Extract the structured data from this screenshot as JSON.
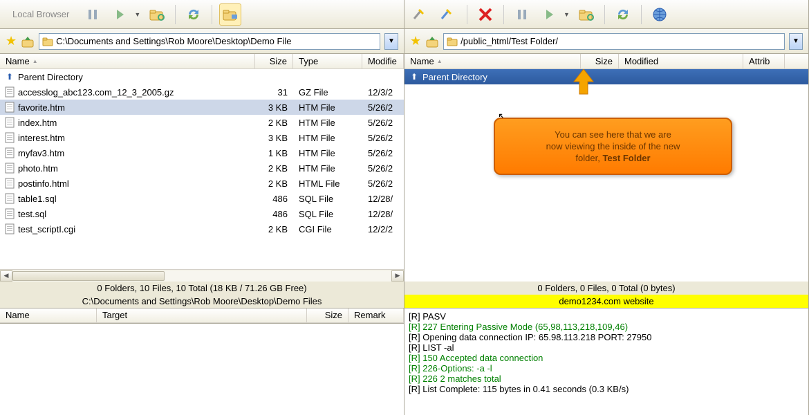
{
  "left": {
    "toolbar_label": "Local Browser",
    "address": "C:\\Documents and Settings\\Rob Moore\\Desktop\\Demo File",
    "columns": {
      "name": "Name",
      "size": "Size",
      "type": "Type",
      "modified": "Modifie"
    },
    "parent_dir": "Parent Directory",
    "files": [
      {
        "name": "accesslog_abc123.com_12_3_2005.gz",
        "size": "31",
        "type": "GZ File",
        "mod": "12/3/2"
      },
      {
        "name": "favorite.htm",
        "size": "3 KB",
        "type": "HTM File",
        "mod": "5/26/2",
        "selected": true
      },
      {
        "name": "index.htm",
        "size": "2 KB",
        "type": "HTM File",
        "mod": "5/26/2"
      },
      {
        "name": "interest.htm",
        "size": "3 KB",
        "type": "HTM File",
        "mod": "5/26/2"
      },
      {
        "name": "myfav3.htm",
        "size": "1 KB",
        "type": "HTM File",
        "mod": "5/26/2"
      },
      {
        "name": "photo.htm",
        "size": "2 KB",
        "type": "HTM File",
        "mod": "5/26/2"
      },
      {
        "name": "postinfo.html",
        "size": "2 KB",
        "type": "HTML File",
        "mod": "5/26/2"
      },
      {
        "name": "table1.sql",
        "size": "486",
        "type": "SQL File",
        "mod": "12/28/"
      },
      {
        "name": "test.sql",
        "size": "486",
        "type": "SQL File",
        "mod": "12/28/"
      },
      {
        "name": "test_scriptI.cgi",
        "size": "2 KB",
        "type": "CGI File",
        "mod": "12/2/2"
      }
    ],
    "status1": "0 Folders, 10 Files, 10 Total (18 KB / 71.26 GB Free)",
    "status2": "C:\\Documents and Settings\\Rob Moore\\Desktop\\Demo Files",
    "queue_cols": {
      "name": "Name",
      "target": "Target",
      "size": "Size",
      "remark": "Remark"
    }
  },
  "right": {
    "address": "/public_html/Test Folder/",
    "columns": {
      "name": "Name",
      "size": "Size",
      "modified": "Modified",
      "attrib": "Attrib"
    },
    "parent_dir": "Parent Directory",
    "status1": "0 Folders, 0 Files, 0 Total (0 bytes)",
    "status2": "demo1234.com website",
    "log": [
      {
        "cls": "log-black",
        "text": "[R] PASV"
      },
      {
        "cls": "log-green",
        "text": "[R] 227 Entering Passive Mode (65,98,113,218,109,46)"
      },
      {
        "cls": "log-black",
        "text": "[R] Opening data connection IP: 65.98.113.218 PORT: 27950"
      },
      {
        "cls": "log-black",
        "text": "[R] LIST -al"
      },
      {
        "cls": "log-green",
        "text": "[R] 150 Accepted data connection"
      },
      {
        "cls": "log-green",
        "text": "[R] 226-Options: -a -l"
      },
      {
        "cls": "log-green",
        "text": "[R] 226 2 matches total"
      },
      {
        "cls": "log-black",
        "text": "[R] List Complete: 115 bytes in 0.41 seconds (0.3 KB/s)"
      }
    ]
  },
  "tooltip": {
    "line1": "You can see here that we are",
    "line2": "now viewing the inside of the new",
    "line3": "folder, ",
    "bold": "Test Folder"
  }
}
